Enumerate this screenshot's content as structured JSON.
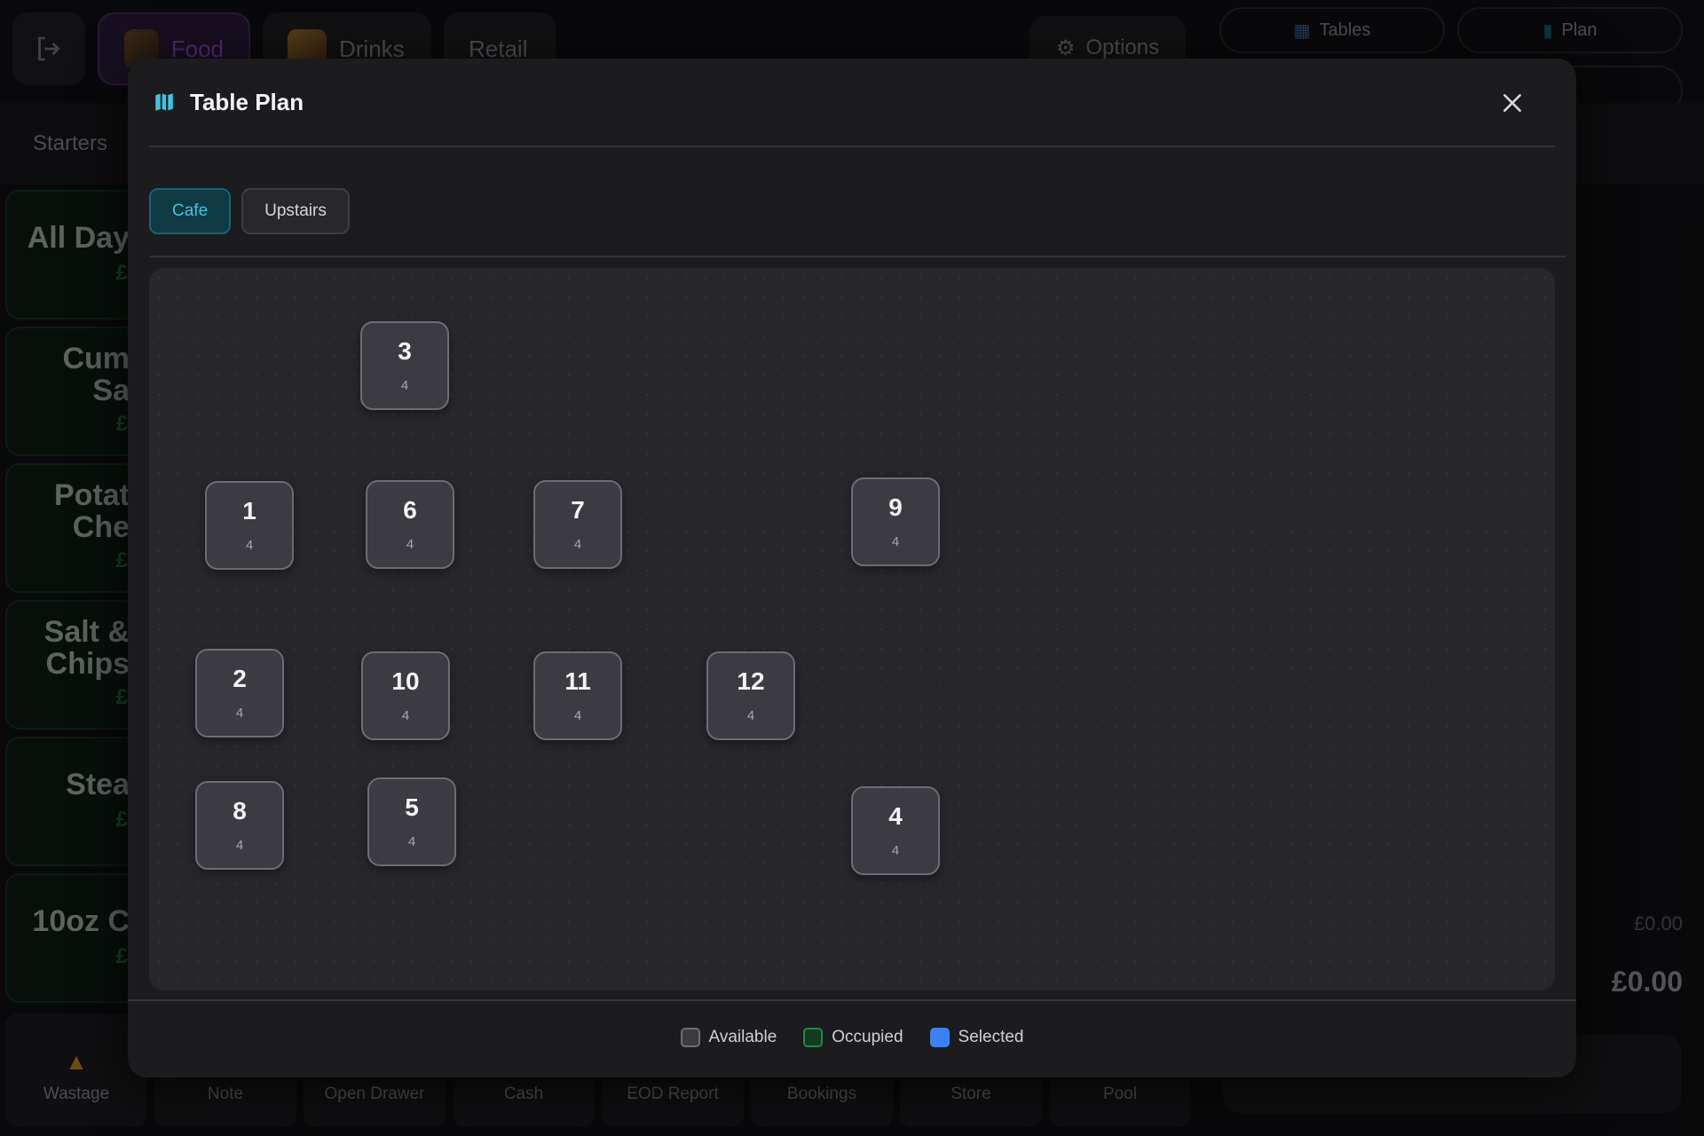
{
  "app": {
    "categories": [
      {
        "label": "Food",
        "active": true
      },
      {
        "label": "Drinks",
        "active": false
      },
      {
        "label": "Retail",
        "active": false
      }
    ],
    "options_label": "Options",
    "tables_label": "Tables",
    "plan_label": "Plan",
    "subcategory": "Starters",
    "items": [
      {
        "name_line1": "All Day",
        "name_line2": "",
        "price": "£"
      },
      {
        "name_line1": "Cum",
        "name_line2": "Sa",
        "price": "£"
      },
      {
        "name_line1": "Potat",
        "name_line2": "Che",
        "price": "£"
      },
      {
        "name_line1": "Salt &",
        "name_line2": "Chips",
        "price": "£"
      },
      {
        "name_line1": "Stea",
        "name_line2": "",
        "price": "£"
      },
      {
        "name_line1": "10oz C",
        "name_line2": "",
        "price": "£"
      }
    ],
    "subtotal": "£0.00",
    "total": "£0.00",
    "bottom_buttons": [
      "Wastage",
      "Note",
      "Open Drawer",
      "Cash",
      "EOD Report",
      "Bookings",
      "Store",
      "Pool"
    ]
  },
  "modal": {
    "title": "Table Plan",
    "title_icon": "map-icon",
    "close_icon": "close-icon",
    "areas": [
      {
        "label": "Cafe",
        "active": true
      },
      {
        "label": "Upstairs",
        "active": false
      }
    ],
    "tables": [
      {
        "number": "3",
        "seats": "4",
        "status": "available"
      },
      {
        "number": "1",
        "seats": "4",
        "status": "available"
      },
      {
        "number": "6",
        "seats": "4",
        "status": "available"
      },
      {
        "number": "7",
        "seats": "4",
        "status": "available"
      },
      {
        "number": "9",
        "seats": "4",
        "status": "available"
      },
      {
        "number": "2",
        "seats": "4",
        "status": "available"
      },
      {
        "number": "10",
        "seats": "4",
        "status": "available"
      },
      {
        "number": "11",
        "seats": "4",
        "status": "available"
      },
      {
        "number": "12",
        "seats": "4",
        "status": "available"
      },
      {
        "number": "8",
        "seats": "4",
        "status": "available"
      },
      {
        "number": "5",
        "seats": "4",
        "status": "available"
      },
      {
        "number": "4",
        "seats": "4",
        "status": "available"
      }
    ],
    "legend": [
      {
        "label": "Available",
        "color": "#3b3b41",
        "border": "#6c6c74"
      },
      {
        "label": "Occupied",
        "color": "#143a22",
        "border": "#1f8a47"
      },
      {
        "label": "Selected",
        "color": "#3b82f6",
        "border": "#3b82f6"
      }
    ]
  },
  "colors": {
    "accent": "#3fc4de",
    "food_accent": "#8e4fc6",
    "price_green": "#1b7a3c"
  }
}
